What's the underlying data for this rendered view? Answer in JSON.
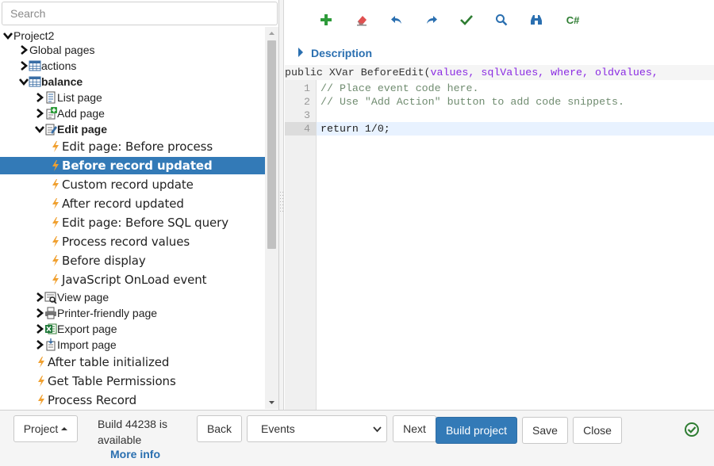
{
  "search": {
    "placeholder": "Search"
  },
  "tree": [
    {
      "label": "Project2",
      "icon": "none",
      "twisty": "expanded",
      "indent": 0,
      "style": "small"
    },
    {
      "label": "Global pages",
      "icon": "none",
      "twisty": "collapsed",
      "indent": 1,
      "style": "small"
    },
    {
      "label": "actions",
      "icon": "table-icon",
      "twisty": "collapsed",
      "indent": 1,
      "style": "small"
    },
    {
      "label": "balance",
      "icon": "table-icon",
      "twisty": "expanded",
      "indent": 1,
      "style": "small bold"
    },
    {
      "label": "List page",
      "icon": "list-page-icon",
      "twisty": "collapsed",
      "indent": 2,
      "style": "small"
    },
    {
      "label": "Add page",
      "icon": "add-page-icon",
      "twisty": "collapsed",
      "indent": 2,
      "style": "small"
    },
    {
      "label": "Edit page",
      "icon": "edit-page-icon",
      "twisty": "expanded",
      "indent": 2,
      "style": "small bold"
    },
    {
      "label": "Edit page: Before process",
      "icon": "event-icon",
      "twisty": "none",
      "indent": 3,
      "style": "ev"
    },
    {
      "label": "Before record updated",
      "icon": "event-icon",
      "twisty": "none",
      "indent": 3,
      "style": "ev selected"
    },
    {
      "label": "Custom record update",
      "icon": "event-icon",
      "twisty": "none",
      "indent": 3,
      "style": "ev"
    },
    {
      "label": "After record updated",
      "icon": "event-icon",
      "twisty": "none",
      "indent": 3,
      "style": "ev"
    },
    {
      "label": "Edit page: Before SQL query",
      "icon": "event-icon",
      "twisty": "none",
      "indent": 3,
      "style": "ev"
    },
    {
      "label": "Process record values",
      "icon": "event-icon",
      "twisty": "none",
      "indent": 3,
      "style": "ev"
    },
    {
      "label": "Before display",
      "icon": "event-icon",
      "twisty": "none",
      "indent": 3,
      "style": "ev"
    },
    {
      "label": "JavaScript OnLoad event",
      "icon": "event-icon",
      "twisty": "none",
      "indent": 3,
      "style": "ev"
    },
    {
      "label": "View page",
      "icon": "view-page-icon",
      "twisty": "collapsed",
      "indent": 2,
      "style": "small"
    },
    {
      "label": "Printer-friendly page",
      "icon": "printer-icon",
      "twisty": "collapsed",
      "indent": 2,
      "style": "small"
    },
    {
      "label": "Export page",
      "icon": "excel-icon",
      "twisty": "collapsed",
      "indent": 2,
      "style": "small"
    },
    {
      "label": "Import page",
      "icon": "import-icon",
      "twisty": "collapsed",
      "indent": 2,
      "style": "small"
    },
    {
      "label": "After table initialized",
      "icon": "event-icon",
      "twisty": "none",
      "indent": 2,
      "style": "ev"
    },
    {
      "label": "Get Table Permissions",
      "icon": "event-icon",
      "twisty": "none",
      "indent": 2,
      "style": "ev"
    },
    {
      "label": "Process Record",
      "icon": "event-icon",
      "twisty": "none",
      "indent": 2,
      "style": "ev"
    }
  ],
  "toolbar": {
    "add": "plus-icon",
    "erase": "eraser-icon",
    "undo": "undo-icon",
    "redo": "redo-icon",
    "check": "check-icon",
    "search": "search-icon",
    "find": "binoculars-icon",
    "csharp_label": "C#"
  },
  "description": {
    "label": "Description"
  },
  "editor": {
    "signature_prefix": "public XVar BeforeEdit(",
    "signature_params": "values, sqlValues, where, oldvalues,",
    "lines": [
      {
        "num": "1",
        "code": "// Place event code here.",
        "kind": "comment"
      },
      {
        "num": "2",
        "code": "// Use \"Add Action\" button to add code snippets.",
        "kind": "comment"
      },
      {
        "num": "3",
        "code": "",
        "kind": "code"
      },
      {
        "num": "4",
        "code": "return 1/0;",
        "kind": "code",
        "active": true
      }
    ]
  },
  "footer": {
    "project_label": "Project",
    "build_line1": "Build 44238 is",
    "build_line2": "available",
    "more_info": "More info",
    "back_label": "Back",
    "events_value": "Events",
    "next_label": "Next",
    "build_label": "Build project",
    "save_label": "Save",
    "close_label": "Close"
  },
  "colors": {
    "accent": "#337ab7",
    "link": "#2a6fb0",
    "ok": "#2e7d32",
    "event_bolt": "#f0a030"
  }
}
